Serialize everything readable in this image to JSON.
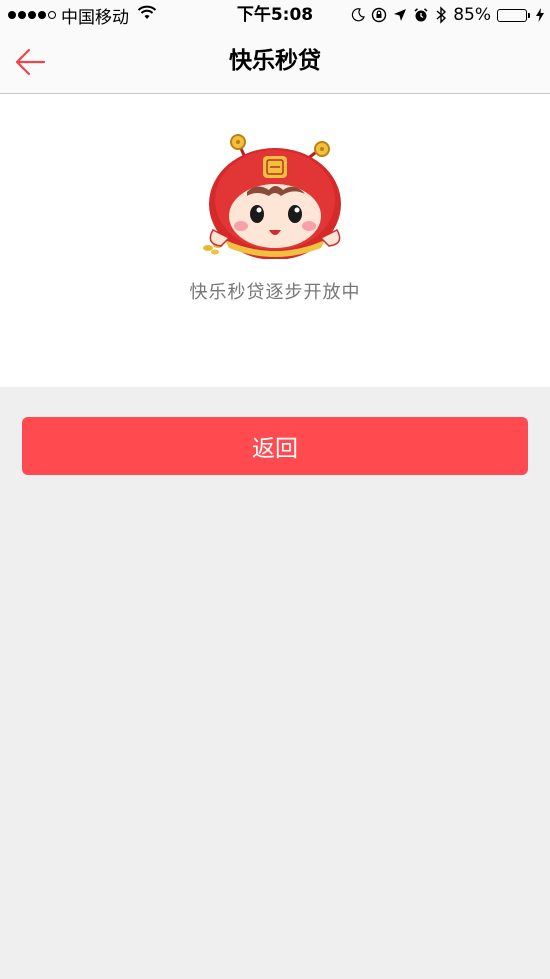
{
  "status_bar": {
    "carrier": "中国移动",
    "time": "下午5:08",
    "battery_percent": "85%",
    "battery_level": 0.85,
    "signal_bars_filled": 4,
    "signal_bars_total": 5,
    "icons": [
      "wifi-icon",
      "moon-icon",
      "orientation-lock-icon",
      "location-icon",
      "alarm-icon",
      "bluetooth-icon",
      "charging-icon"
    ]
  },
  "nav": {
    "title": "快乐秒贷",
    "back_icon": "back-arrow-icon",
    "accent_color": "#f0444a"
  },
  "content": {
    "message": "快乐秒贷逐步开放中",
    "mascot": "red-hooded-mascot-image"
  },
  "actions": {
    "return_label": "返回",
    "return_color": "#ff4a4f"
  }
}
